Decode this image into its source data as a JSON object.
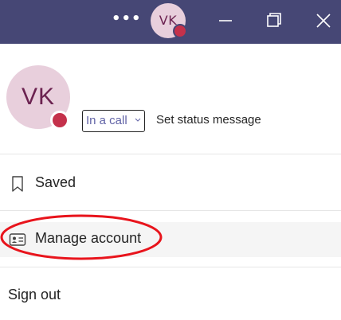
{
  "titlebar": {
    "more_label": "•••",
    "avatar_initials": "VK",
    "presence_color": "#c4314b",
    "background_color": "#464775",
    "icons": [
      "more-icon",
      "minimize-icon",
      "restore-icon",
      "close-icon"
    ]
  },
  "profile": {
    "initials": "VK",
    "status": "In a call",
    "set_status_label": "Set status message"
  },
  "menu": {
    "saved_label": "Saved",
    "manage_account_label": "Manage account",
    "sign_out_label": "Sign out"
  },
  "annotation": {
    "color": "#e8141c"
  }
}
